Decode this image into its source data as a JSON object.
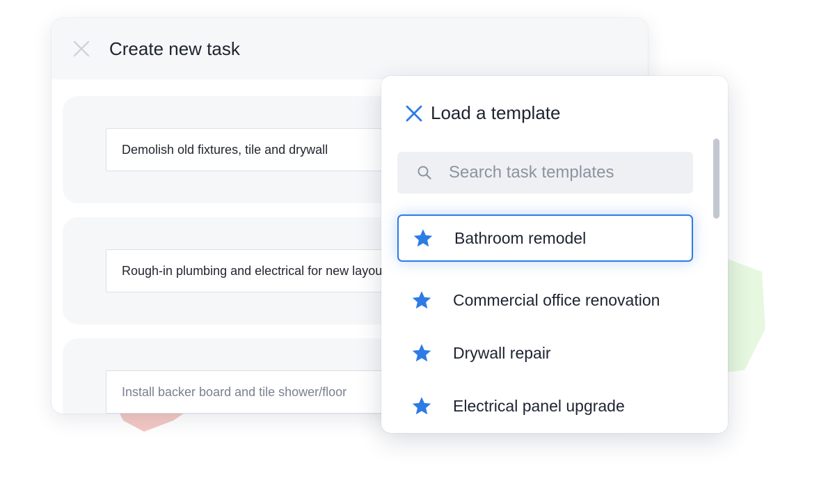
{
  "task_dialog": {
    "title": "Create new task",
    "close_icon": "close-icon",
    "rows": [
      {
        "text": "Demolish old fixtures, tile and drywall"
      },
      {
        "text": "Rough-in plumbing and electrical for new layout"
      },
      {
        "text": "Install  backer board and tile shower/floor"
      }
    ]
  },
  "template_picker": {
    "title": "Load a template",
    "close_icon": "close-icon",
    "search": {
      "placeholder": "Search task templates",
      "value": ""
    },
    "items": [
      {
        "label": "Bathroom remodel",
        "icon": "star-icon",
        "selected": true
      },
      {
        "label": "Commercial office renovation",
        "icon": "star-icon",
        "selected": false
      },
      {
        "label": "Drywall repair",
        "icon": "star-icon",
        "selected": false
      },
      {
        "label": "Electrical panel upgrade",
        "icon": "star-icon",
        "selected": false
      }
    ]
  },
  "colors": {
    "accent": "#2d7be5",
    "panel_bg": "#f6f7f9",
    "text": "#1d2330"
  }
}
